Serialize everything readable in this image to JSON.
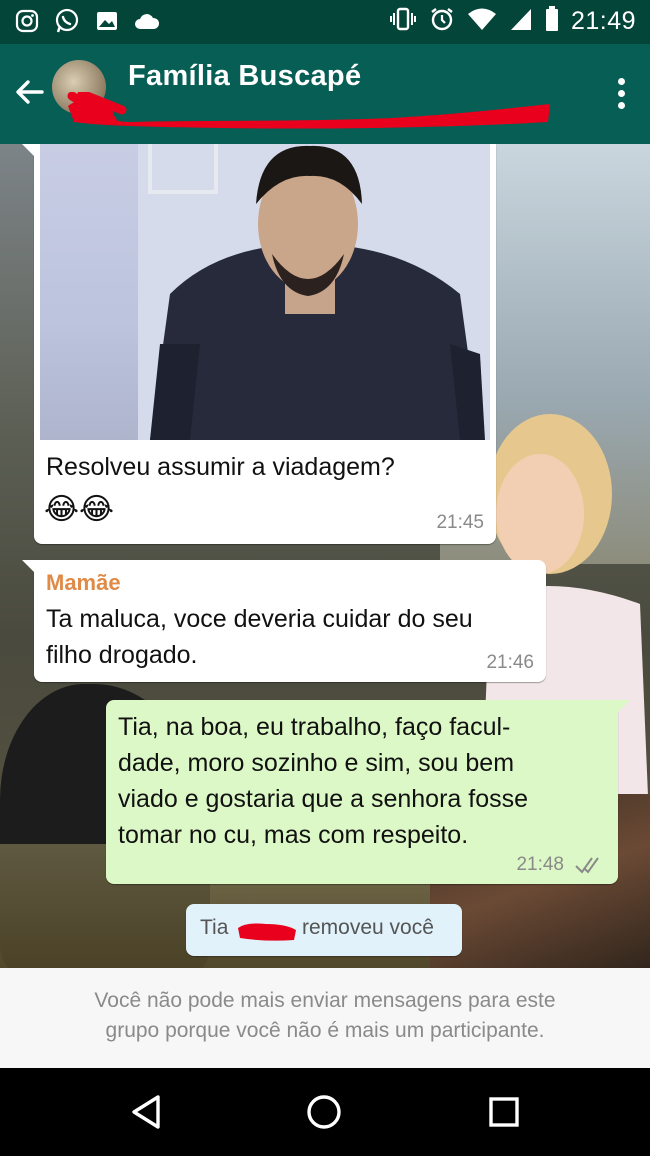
{
  "status_bar": {
    "time": "21:49",
    "left_icons": [
      "instagram-icon",
      "whatsapp-icon",
      "image-icon",
      "cloud-icon"
    ],
    "right_icons": [
      "vibrate-icon",
      "alarm-icon",
      "wifi-icon",
      "signal-icon",
      "battery-icon"
    ]
  },
  "header": {
    "title": "Família Buscapé"
  },
  "messages": [
    {
      "type": "incoming-image",
      "text": "Resolveu assumir a viadagem?",
      "emoji": "😂😂",
      "time": "21:45"
    },
    {
      "type": "incoming",
      "sender": "Mamãe",
      "line1": "Ta maluca, voce deveria cuidar do seu",
      "line2": "filho drogado.",
      "time": "21:46"
    },
    {
      "type": "outgoing",
      "line1": "Tia, na boa, eu trabalho, faço facul-",
      "line2": "dade, moro sozinho e sim, sou bem",
      "line3": "viado e gostaria que a senhora fosse",
      "line4": "tomar no cu, mas com respeito.",
      "time": "21:48"
    }
  ],
  "system_message": {
    "prefix": "Tia",
    "suffix": "removeu você"
  },
  "footer": {
    "line1": "Você não pode mais enviar mensagens para este",
    "line2": "grupo porque você não é mais um participante."
  },
  "colors": {
    "status_bar": "#04453a",
    "app_bar": "#075e54",
    "outgoing_bubble": "#dcf8c6",
    "sender_name": "#e08a48",
    "redaction": "#e8001c"
  }
}
